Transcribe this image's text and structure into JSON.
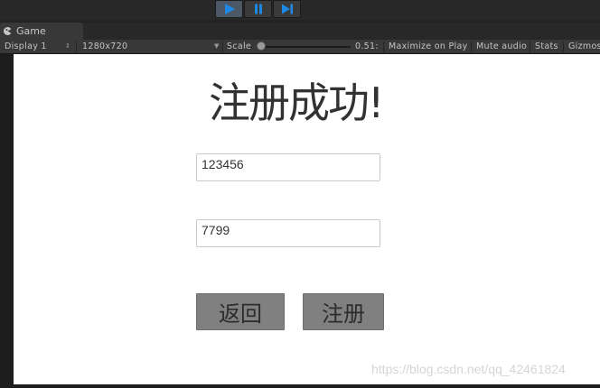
{
  "window": {
    "tab_label": "Game"
  },
  "toolbar": {
    "display": "Display 1",
    "resolution": "1280x720",
    "scale_label": "Scale",
    "scale_value": "0.51:",
    "scale_level": 0.0,
    "maximize_on_play": "Maximize on Play",
    "mute_audio": "Mute audio",
    "stats": "Stats",
    "gizmos": "Gizmos"
  },
  "game": {
    "title": "注册成功!",
    "username_value": "123456",
    "password_value": "7799",
    "back_button": "返回",
    "register_button": "注册"
  },
  "watermark": "https://blog.csdn.net/qq_42461824",
  "colors": {
    "play_active": "#1e88e5",
    "button_bg": "#808080"
  }
}
